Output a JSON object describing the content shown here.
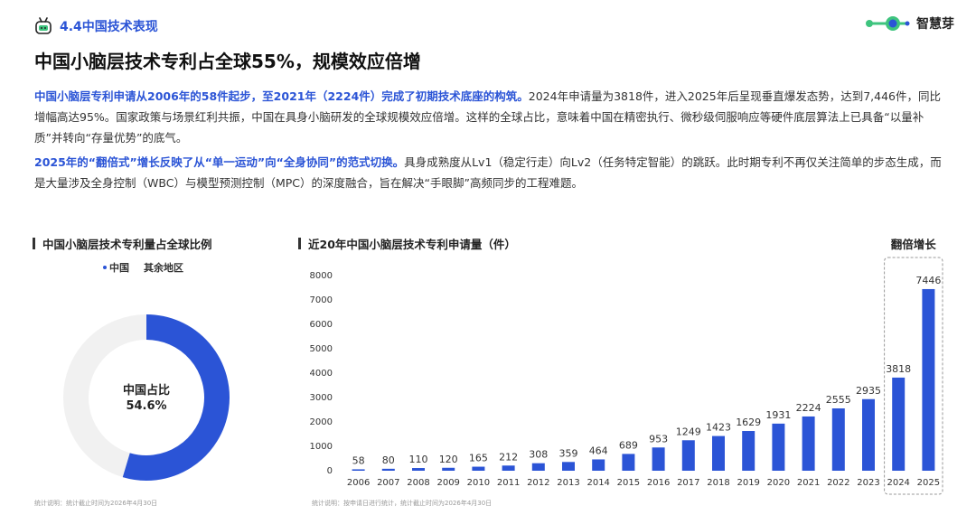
{
  "header": {
    "section_label": "4.4中国技术表现",
    "logo_name": "智慧芽",
    "title": "中国小脑层技术专利占全球55%，规模效应倍增"
  },
  "paragraphs": {
    "p1_highlight": "中国小脑层专利申请从2006年的58件起步，至2021年（2224件）完成了初期技术底座的构筑。",
    "p1_body": "2024年申请量为3818件，进入2025年后呈现垂直爆发态势，达到7,446件，同比增幅高达95%。国家政策与场景红利共振，中国在具身小脑研发的全球规模效应倍增。这样的全球占比，意味着中国在精密执行、微秒级伺服响应等硬件底层算法上已具备“以量补质”并转向“存量优势”的底气。",
    "p2_highlight": "2025年的“翻倍式”增长反映了从“单一运动”向“全身协同”的范式切换。",
    "p2_body": "具身成熟度从Lv1（稳定行走）向Lv2（任务特定智能）的跳跃。此时期专利不再仅关注简单的步态生成，而是大量涉及全身控制（WBC）与模型预测控制（MPC）的深度融合，旨在解决“手眼脚”高频同步的工程难题。"
  },
  "donut_card": {
    "title": "中国小脑层技术专利量占全球比例",
    "center_label": "中国占比",
    "center_value": "54.6%",
    "footnote": "统计说明：统计截止时间为2026年4月30日"
  },
  "bar_card": {
    "title": "近20年中国小脑层技术专利申请量（件）",
    "callout": "翻倍增长",
    "footnote": "统计说明：按申请日进行统计，统计截止时间为2026年4月30日"
  },
  "colors": {
    "accent": "#2b54d6",
    "donut_rest": "#f1f1f1",
    "highlight_box": "#999999"
  },
  "chart_data": [
    {
      "type": "pie",
      "title": "中国小脑层技术专利量占全球比例",
      "categories": [
        "中国",
        "其余地区"
      ],
      "values": [
        54.6,
        45.4
      ],
      "legend": "top-left"
    },
    {
      "type": "bar",
      "title": "近20年中国小脑层技术专利申请量（件）",
      "categories": [
        "2006",
        "2007",
        "2008",
        "2009",
        "2010",
        "2011",
        "2012",
        "2013",
        "2014",
        "2015",
        "2016",
        "2017",
        "2018",
        "2019",
        "2020",
        "2021",
        "2022",
        "2023",
        "2024",
        "2025"
      ],
      "values": [
        58,
        80,
        110,
        120,
        165,
        212,
        308,
        359,
        464,
        689,
        953,
        1249,
        1423,
        1629,
        1931,
        2224,
        2555,
        2935,
        3818,
        7446
      ],
      "yticks": [
        0,
        1000,
        2000,
        3000,
        4000,
        5000,
        6000,
        7000,
        8000
      ],
      "ylim": [
        0,
        8000
      ],
      "grid": false,
      "highlight_categories": [
        "2024",
        "2025"
      ]
    }
  ]
}
